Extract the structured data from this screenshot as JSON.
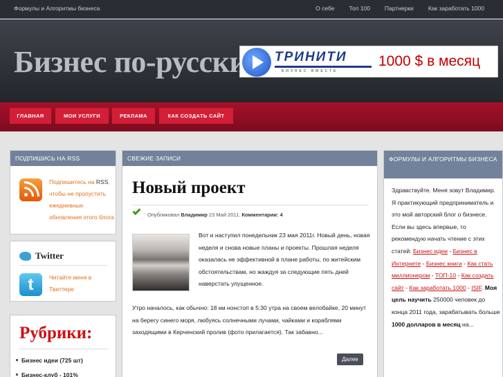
{
  "topbar": {
    "site_title": "Формулы и Алгоритмы бизнеса",
    "links": [
      "О себе",
      "Топ 100",
      "Партнерки",
      "Как заработать 1000"
    ]
  },
  "header": {
    "logo": "Бизнес по-русски",
    "banner": {
      "brand": "ТРИНИТИ",
      "tagline": "БИЗНЕС ВМЕСТЕ",
      "offer": "1000 $ в месяц"
    }
  },
  "mainnav": [
    "Главная",
    "Мои услуги",
    "Реклама",
    "Как создать сайт"
  ],
  "rss": {
    "title": "Подпишись на RSS",
    "text_link1": "Подпишитесь на",
    "text_rss": "RSS",
    "text_rest": ", чтобы не пропустить ежедневные обновления этого блога"
  },
  "twitter": {
    "heading": "Twitter",
    "text": "Читайте меня в Твиттере"
  },
  "rubrics": {
    "title": "Рубрики:",
    "items": [
      "Бизнес идеи (725 шт)",
      "Бизнес-клуб - 101%"
    ]
  },
  "posts": {
    "section_title": "Свежие записи",
    "post_title": "Новый проект",
    "meta_prefix": "Опубликовал",
    "author": "Владимир",
    "date": "23 Май 2011.",
    "comments_label": "Комментарии:",
    "comments_count": "4",
    "excerpt_part1": "Вот и наступил понедельник 23 мая 2011г. Новый день, новая неделя и снова новые планы и проекты. Прошлая неделя оказалась не эффективной в плане работы, по житейским обстоятельствам, но жаждуя за следующие пять дней наверстать упущенное.",
    "excerpt_part2": "Утро началось, как обычно: 18 км нонстоп в 5:30 утра на своем велобайке, 20 минут на берегу синего моря, любуясь солнечными лучами, чайками и кораблями заходящими в Керченский пролив (фото прилагается). Так забавно...",
    "more_label": "Далее"
  },
  "right": {
    "title": "Формулы и Алгоритмы бизнеса",
    "intro": "Здравствуйте. Меня зовут Владимир. Я практикующий предприниматель и это мой авторский блог о бизнесе. Если вы здесь впервые, то рекомендую начать чтение с этих статей:",
    "link1": "Бизнес идеи",
    "link2": "Бизнес в Интернете",
    "link3": "Бизнес книги",
    "link4": "Как стать миллионером",
    "link5": "ТОП-10",
    "link6": "Как создать сайт",
    "link7": "Как заработать 1000",
    "link8": "ISIF",
    "goal_label": "Моя цель научить",
    "goal_text": "250000 человек до конца 2011 года, зарабатывать больше",
    "goal_bold": "1000 долларов в месяц",
    "goal_tail": "на..."
  }
}
